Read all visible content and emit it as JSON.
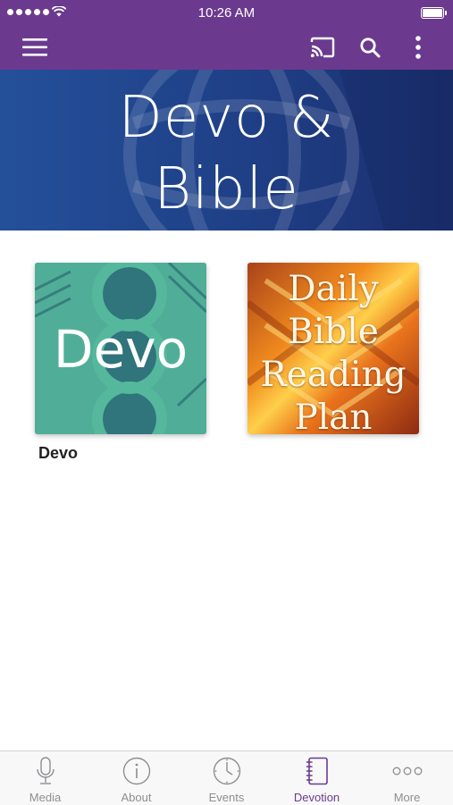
{
  "status_bar": {
    "time": "10:26 AM"
  },
  "nav_bar": {
    "menu_icon": "hamburger-menu-icon",
    "cast_icon": "cast-icon",
    "search_icon": "search-icon",
    "more_icon": "more-vertical-icon"
  },
  "banner": {
    "title_line1": "Devo &",
    "title_line2": "Bible"
  },
  "items": [
    {
      "image_text": "Devo",
      "caption": "Devo"
    },
    {
      "image_text_lines": [
        "Daily",
        "Bible",
        "Reading",
        "Plan"
      ],
      "caption": ""
    }
  ],
  "tab_bar": {
    "tabs": [
      {
        "label": "Media",
        "icon": "microphone-icon"
      },
      {
        "label": "About",
        "icon": "info-icon"
      },
      {
        "label": "Events",
        "icon": "clock-icon"
      },
      {
        "label": "Devotion",
        "icon": "notebook-icon",
        "active": true
      },
      {
        "label": "More",
        "icon": "more-dots-icon"
      }
    ]
  },
  "colors": {
    "brand_purple": "#6b3a8e",
    "banner_blue": "#24509a",
    "tab_inactive": "#8e8e93"
  }
}
